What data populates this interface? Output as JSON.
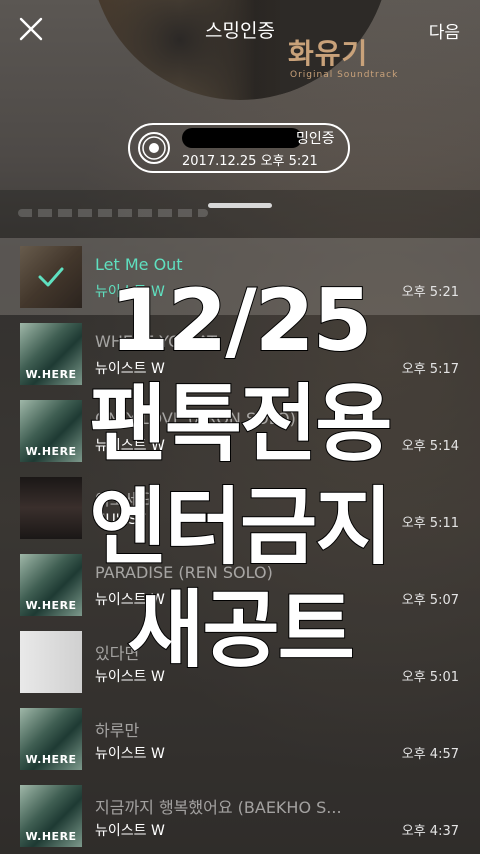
{
  "header": {
    "title": "스밍인증",
    "next_label": "다음",
    "album_art_text": "화유기",
    "album_art_subtext": "Original Soundtrack"
  },
  "certificate": {
    "suffix": "밍인증",
    "date": "2017.12.25 오후 5:21"
  },
  "songs": [
    {
      "title": "Let Me Out",
      "artist": "뉴이스트 W",
      "time": "오후 5:21",
      "selected": true,
      "art": "first"
    },
    {
      "title": "WHERE YOU AT",
      "artist": "뉴이스트 W",
      "time": "오후 5:17",
      "art": "where",
      "art_label": "W.HERE"
    },
    {
      "title": "ONLY LOVE (ARON SOLO)",
      "artist": "뉴이스트 W",
      "time": "오후 5:14",
      "art": "where",
      "art_label": "W.HERE"
    },
    {
      "title": "여보세요",
      "artist": "NU'EST",
      "time": "오후 5:11",
      "art": "yeobo"
    },
    {
      "title": "PARADISE (REN SOLO)",
      "artist": "뉴이스트 W",
      "time": "오후 5:07",
      "art": "where",
      "art_label": "W.HERE"
    },
    {
      "title": "있다면",
      "artist": "뉴이스트 W",
      "time": "오후 5:01",
      "art": "gray"
    },
    {
      "title": "하루만",
      "artist": "뉴이스트 W",
      "time": "오후 4:57",
      "art": "where",
      "art_label": "W.HERE"
    },
    {
      "title": "지금까지 행복했어요 (BAEKHO S...",
      "artist": "뉴이스트 W",
      "time": "오후 4:37",
      "art": "where",
      "art_label": "W.HERE"
    }
  ],
  "overlay_text": [
    "12/25",
    "팬톡전용",
    "엔터금지",
    "새공트"
  ],
  "colors": {
    "accent": "#5fe0c0",
    "overlay_stroke": "#000000"
  }
}
